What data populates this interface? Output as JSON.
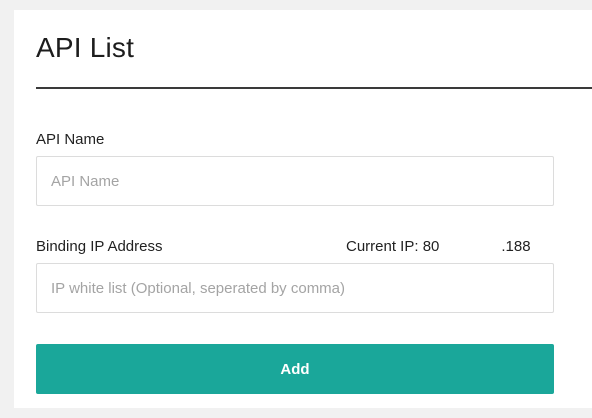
{
  "page": {
    "title": "API List"
  },
  "form": {
    "api_name": {
      "label": "API Name",
      "value": "",
      "placeholder": "API Name"
    },
    "binding_ip": {
      "label": "Binding IP Address",
      "current_ip_label": "Current IP:",
      "current_ip_start": "80",
      "current_ip_end": ".188",
      "value": "",
      "placeholder": "IP white list (Optional, seperated by comma)"
    },
    "submit_label": "Add"
  },
  "colors": {
    "accent": "#1aa79a",
    "background": "#f1f1f1",
    "panel": "#ffffff",
    "divider": "#3a3a3a"
  }
}
